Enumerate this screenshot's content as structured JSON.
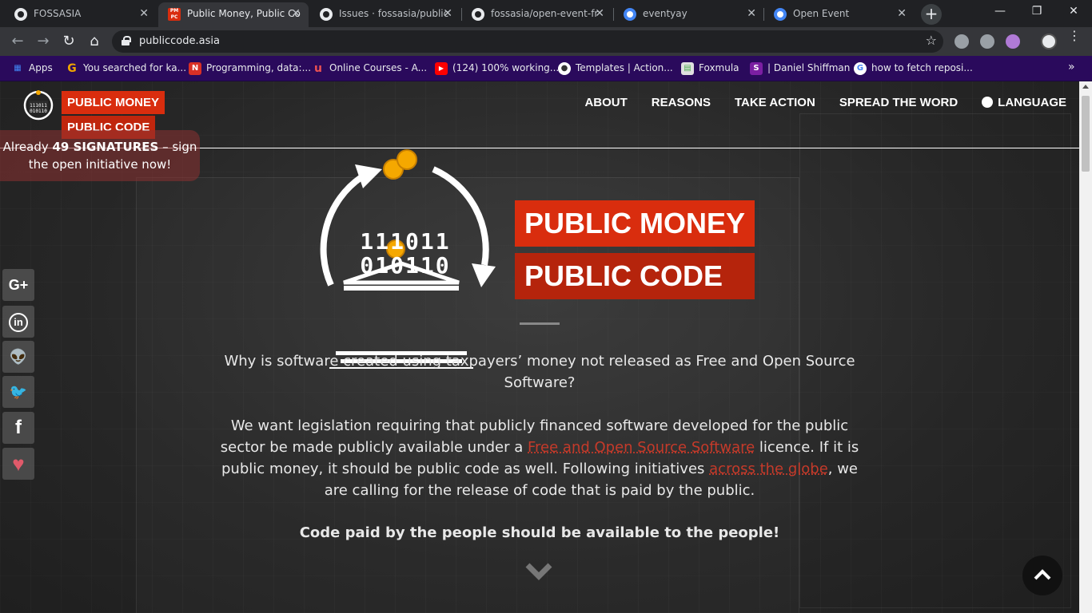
{
  "browser": {
    "tabs": [
      {
        "title": "FOSSASIA",
        "icon": "github-icon"
      },
      {
        "title": "Public Money, Public Co",
        "icon": "pmpc-icon",
        "active": true
      },
      {
        "title": "Issues · fossasia/public",
        "icon": "github-icon"
      },
      {
        "title": "fossasia/open-event-fr",
        "icon": "github-icon"
      },
      {
        "title": "eventyay",
        "icon": "eventyay-icon"
      },
      {
        "title": "Open Event",
        "icon": "eventyay-icon"
      }
    ],
    "close_glyph": "✕",
    "new_tab_glyph": "+",
    "url": "publiccode.asia",
    "bookmarks": [
      {
        "label": "Apps",
        "icon": "apps-grid-icon",
        "color": "#4285f4"
      },
      {
        "label": "You searched for ka...",
        "icon": "g-icon",
        "color": "#f0a500"
      },
      {
        "label": "Programming, data:...",
        "icon": "n-icon",
        "color": "#d93025"
      },
      {
        "label": "Online Courses - A...",
        "icon": "udemy-icon",
        "color": "#ec5252"
      },
      {
        "label": "(124) 100% working...",
        "icon": "youtube-icon",
        "color": "#ff0000"
      },
      {
        "label": "Templates | Action...",
        "icon": "templates-icon",
        "color": "#ffffff"
      },
      {
        "label": "Foxmula",
        "icon": "foxmula-icon",
        "color": "#4caf50"
      },
      {
        "label": "| Daniel Shiffman",
        "icon": "s-icon",
        "color": "#7b1fa2"
      },
      {
        "label": "how to fetch reposi...",
        "icon": "google-icon",
        "color": "#ffffff"
      }
    ]
  },
  "site": {
    "logo_tag_1": "PUBLIC MONEY",
    "logo_tag_2": "PUBLIC CODE",
    "nav": [
      "ABOUT",
      "REASONS",
      "TAKE ACTION",
      "SPREAD THE WORD",
      "LANGUAGE"
    ],
    "signatures_pre": "Already ",
    "signatures_count": "49 SIGNATURES",
    "signatures_post": " – sign the open initiative now!",
    "hero_tag_1": "PUBLIC MONEY",
    "hero_tag_2": "PUBLIC CODE",
    "binary_1": "111011",
    "binary_2": "010110",
    "question": "Why is software created using taxpayers’ money not released as Free and Open Source Software?",
    "para_a": "We want legislation requiring that publicly financed software developed for the public sector be made publicly available under a ",
    "para_link1": "Free and Open Source Software",
    "para_b": " licence. If it is public money, it should be public code as well. Following initiatives ",
    "para_link2": "across the globe",
    "para_c": ", we are calling for the release of code that is paid by the public.",
    "slogan": "Code paid by the people should be available to the people!",
    "share_buttons": [
      {
        "label": "G+",
        "icon": "google-plus-icon"
      },
      {
        "label": "in",
        "icon": "linkedin-icon"
      },
      {
        "label": "👽",
        "icon": "reddit-icon"
      },
      {
        "label": "🐦",
        "icon": "twitter-icon"
      },
      {
        "label": "f",
        "icon": "facebook-icon"
      },
      {
        "label": "♥",
        "icon": "heart-icon"
      }
    ]
  },
  "colors": {
    "accent": "#d92d0e",
    "accent_dark": "#b5240c",
    "link": "#c53a2a",
    "coin": "#f5a800"
  }
}
